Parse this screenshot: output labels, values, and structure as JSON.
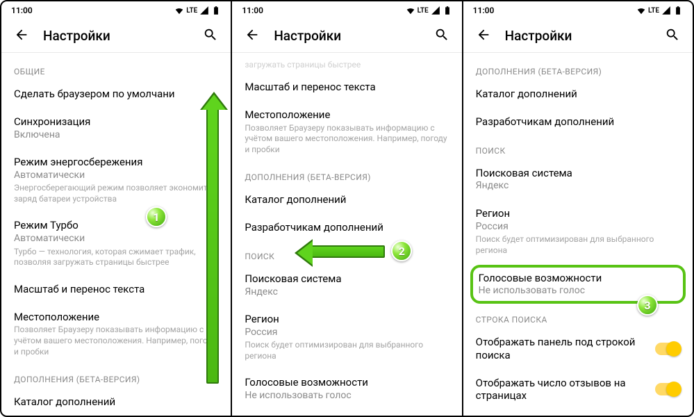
{
  "status": {
    "time": "11:00",
    "net": "LTE"
  },
  "header": {
    "title": "Настройки"
  },
  "panel1": {
    "sections": {
      "general": "ОБЩИЕ",
      "default_browser": "Сделать браузером по умолчани",
      "sync": "Синхронизация",
      "sync_value": "Включена",
      "power": "Режим энергосбережения",
      "power_value": "Автоматически",
      "power_desc": "Энергосберегающий режим позволяет экономить заряд батареи устройства",
      "turbo": "Режим Турбо",
      "turbo_value": "Автоматически",
      "turbo_desc": "Турбо — технология, которая сжимает трафик, позволяя загружать страницы быстрее",
      "zoom": "Масштаб и перенос текста",
      "location": "Местоположение",
      "location_desc": "Позволяет Браузеру показывать информацию с учётом вашего местоположения. Например, погоду и пробки",
      "addons": "ДОПОЛНЕНИЯ (БЕТА-ВЕРСИЯ)",
      "catalog": "Каталог дополнений"
    }
  },
  "panel2": {
    "faded": "загружать страницы быстрее",
    "zoom": "Масштаб и перенос текста",
    "location": "Местоположение",
    "location_desc": "Позволяет Браузеру показывать информацию с учётом вашего местоположения. Например, погоду и пробки",
    "addons": "ДОПОЛНЕНИЯ (БЕТА-ВЕРСИЯ)",
    "catalog": "Каталог дополнений",
    "devs": "Разработчикам дополнений",
    "search": "ПОИСК",
    "engine": "Поисковая система",
    "engine_value": "Яндекс",
    "region": "Регион",
    "region_value": "Россия",
    "region_desc": "Поиск будет оптимизирован для выбранного региона",
    "voice": "Голосовые возможности",
    "voice_value": "Не использовать голос"
  },
  "panel3": {
    "addons": "ДОПОЛНЕНИЯ (БЕТА-ВЕРСИЯ)",
    "catalog": "Каталог дополнений",
    "devs": "Разработчикам дополнений",
    "search": "ПОИСК",
    "engine": "Поисковая система",
    "engine_value": "Яндекс",
    "region": "Регион",
    "region_value": "Россия",
    "region_desc": "Поиск будет оптимизирован для выбранного региона",
    "voice": "Голосовые возможности",
    "voice_value": "Не использовать голос",
    "search_bar": "СТРОКА ПОИСКА",
    "show_panel": "Отображать панель под строкой поиска",
    "show_reviews": "Отображать число отзывов на страницах"
  },
  "badges": {
    "b1": "1",
    "b2": "2",
    "b3": "3"
  }
}
